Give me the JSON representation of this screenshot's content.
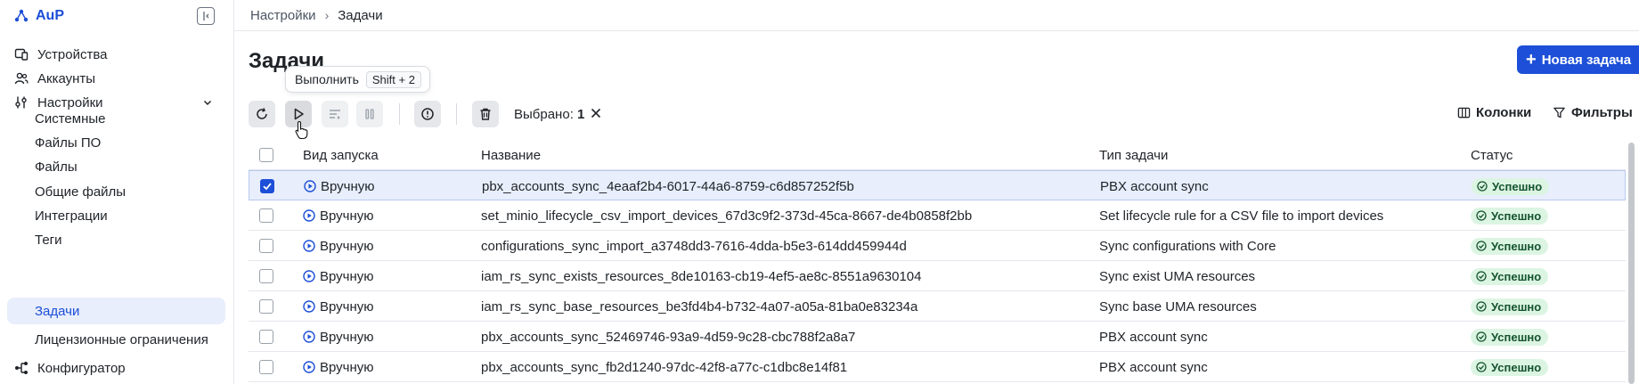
{
  "app": {
    "name": "AuP"
  },
  "sidebar": {
    "items": [
      {
        "label": "Устройства",
        "icon": "devices-icon"
      },
      {
        "label": "Аккаунты",
        "icon": "users-icon"
      },
      {
        "label": "Настройки",
        "icon": "settings-sliders-icon"
      }
    ],
    "sub_items": [
      {
        "label": "Системные",
        "active": false
      },
      {
        "label": "Файлы ПО",
        "active": false
      },
      {
        "label": "Файлы",
        "active": false
      },
      {
        "label": "Общие файлы",
        "active": false
      },
      {
        "label": "Интеграции",
        "active": false
      },
      {
        "label": "Теги",
        "active": false
      },
      {
        "label": "Задачи",
        "active": true
      },
      {
        "label": "Лицензионные ограничения",
        "active": false
      }
    ],
    "last_item": {
      "label": "Конфигуратор",
      "icon": "configurator-icon"
    }
  },
  "breadcrumb": {
    "parent": "Настройки",
    "separator": "›",
    "current": "Задачи"
  },
  "page": {
    "title": "Задачи",
    "new_task_label": "Новая задача"
  },
  "tooltip": {
    "label": "Выполнить",
    "shortcut": "Shift + 2"
  },
  "toolbar": {
    "selected_label": "Выбрано:",
    "selected_count": "1",
    "columns_label": "Колонки",
    "filters_label": "Фильтры"
  },
  "table": {
    "headers": {
      "launch": "Вид запуска",
      "name": "Название",
      "type": "Тип задачи",
      "status": "Статус"
    },
    "rows": [
      {
        "selected": true,
        "launch": "Вручную",
        "name": "pbx_accounts_sync_4eaaf2b4-6017-44a6-8759-c6d857252f5b",
        "type": "PBX account sync",
        "status": "Успешно"
      },
      {
        "selected": false,
        "launch": "Вручную",
        "name": "set_minio_lifecycle_csv_import_devices_67d3c9f2-373d-45ca-8667-de4b0858f2bb",
        "type": "Set lifecycle rule for a CSV file to import devices",
        "status": "Успешно"
      },
      {
        "selected": false,
        "launch": "Вручную",
        "name": "configurations_sync_import_a3748dd3-7616-4dda-b5e3-614dd459944d",
        "type": "Sync configurations with Core",
        "status": "Успешно"
      },
      {
        "selected": false,
        "launch": "Вручную",
        "name": "iam_rs_sync_exists_resources_8de10163-cb19-4ef5-ae8c-8551a9630104",
        "type": "Sync exist UMA resources",
        "status": "Успешно"
      },
      {
        "selected": false,
        "launch": "Вручную",
        "name": "iam_rs_sync_base_resources_be3fd4b4-b732-4a07-a05a-81ba0e83234a",
        "type": "Sync base UMA resources",
        "status": "Успешно"
      },
      {
        "selected": false,
        "launch": "Вручную",
        "name": "pbx_accounts_sync_52469746-93a9-4d59-9c28-cbc788f2a8a7",
        "type": "PBX account sync",
        "status": "Успешно"
      },
      {
        "selected": false,
        "launch": "Вручную",
        "name": "pbx_accounts_sync_fb2d1240-97dc-42f8-a77c-c1dbc8e14f81",
        "type": "PBX account sync",
        "status": "Успешно"
      }
    ]
  },
  "colors": {
    "accent": "#1d4fd8",
    "active_bg": "#e8eefb",
    "success_bg": "#dcf5e3",
    "success_fg": "#14532d"
  }
}
